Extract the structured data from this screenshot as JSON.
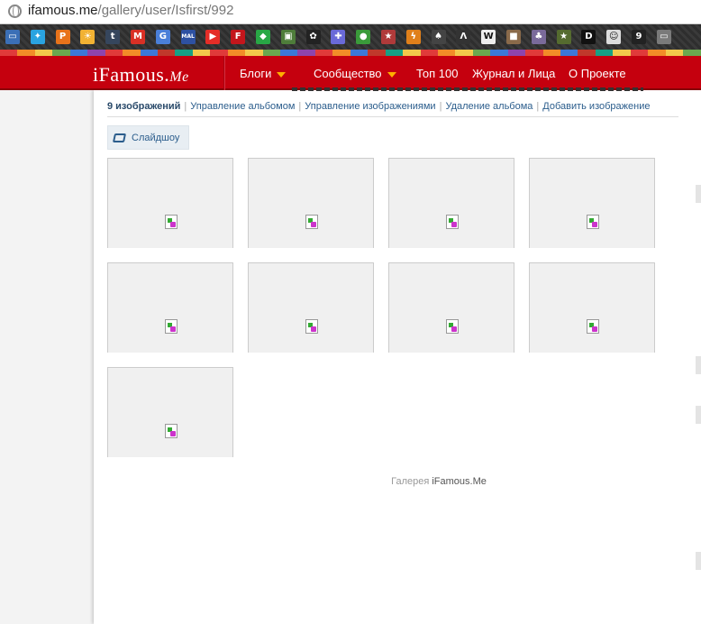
{
  "browser": {
    "url_host": "ifamous.me",
    "url_path": "/gallery/user/Isfirst/992",
    "bookmarks": [
      {
        "name": "chat-icon",
        "glyph": "▭",
        "color": "#3b6fb6"
      },
      {
        "name": "twitter-icon",
        "glyph": "✦",
        "color": "#2aa3e0"
      },
      {
        "name": "p-icon",
        "glyph": "P",
        "color": "#e8731a"
      },
      {
        "name": "sun-icon",
        "glyph": "☀",
        "color": "#f2b233"
      },
      {
        "name": "tumblr-icon",
        "glyph": "t",
        "color": "#36465d"
      },
      {
        "name": "gmail-icon",
        "glyph": "M",
        "color": "#d93025"
      },
      {
        "name": "g-icon",
        "glyph": "G",
        "color": "#4a7fd8"
      },
      {
        "name": "mal-icon",
        "glyph": "MAL",
        "color": "#2e51a2"
      },
      {
        "name": "youtube-icon",
        "glyph": "▶",
        "color": "#e52d27"
      },
      {
        "name": "flag-icon",
        "glyph": "F",
        "color": "#c4161c"
      },
      {
        "name": "gem-icon",
        "glyph": "◆",
        "color": "#28a745"
      },
      {
        "name": "image-icon",
        "glyph": "▣",
        "color": "#4e7d3a"
      },
      {
        "name": "paw-icon",
        "glyph": "✿",
        "color": "#222222"
      },
      {
        "name": "puzzle-icon",
        "glyph": "✚",
        "color": "#6a6ad8"
      },
      {
        "name": "circle-icon",
        "glyph": "●",
        "color": "#3a9b3a"
      },
      {
        "name": "star-badge-icon",
        "glyph": "★",
        "color": "#b03a3a"
      },
      {
        "name": "bolt-icon",
        "glyph": "ϟ",
        "color": "#e0801a"
      },
      {
        "name": "leaf-icon",
        "glyph": "♠",
        "color": "#444444"
      },
      {
        "name": "lambda-icon",
        "glyph": "Λ",
        "color": "#333333"
      },
      {
        "name": "wiki-icon",
        "glyph": "W",
        "color": "#eeeeee"
      },
      {
        "name": "box-icon",
        "glyph": "■",
        "color": "#8a6a4a"
      },
      {
        "name": "anime-icon",
        "glyph": "♣",
        "color": "#7a6a9a"
      },
      {
        "name": "star-icon",
        "glyph": "★",
        "color": "#556b2f"
      },
      {
        "name": "d-icon",
        "glyph": "D",
        "color": "#111111"
      },
      {
        "name": "face-icon",
        "glyph": "☺",
        "color": "#dddddd"
      },
      {
        "name": "nine-icon",
        "glyph": "9",
        "color": "#222222"
      },
      {
        "name": "folder-icon",
        "glyph": "▭",
        "color": "#7a7a7a"
      }
    ],
    "stripe_colors": [
      "#e03a3a",
      "#f28c28",
      "#f2c84b",
      "#6aa84f",
      "#3c78d8",
      "#8e44ad",
      "#e03a3a",
      "#f28c28",
      "#3c78d8",
      "#c0392b",
      "#16a085",
      "#f2c84b"
    ]
  },
  "header": {
    "logo_main": "iFamous.",
    "logo_me": "Me",
    "nav": [
      {
        "label": "Блоги",
        "dropdown": true
      },
      {
        "label": "Сообщество",
        "dropdown": true
      },
      {
        "label": "Топ 100",
        "dropdown": false
      },
      {
        "label": "Журнал и Лица",
        "dropdown": false
      },
      {
        "label": "О Проекте",
        "dropdown": false
      }
    ]
  },
  "gallery": {
    "tabs": {
      "count": "9 изображений",
      "manage_album": "Управление альбомом",
      "manage_images": "Управление изображениями",
      "delete_album": "Удаление альбома",
      "add_image": "Добавить изображение"
    },
    "slideshow_label": "Слайдшоу",
    "image_count": 9
  },
  "footer": {
    "prefix": "Галерея",
    "brand": "iFamous.Me"
  }
}
